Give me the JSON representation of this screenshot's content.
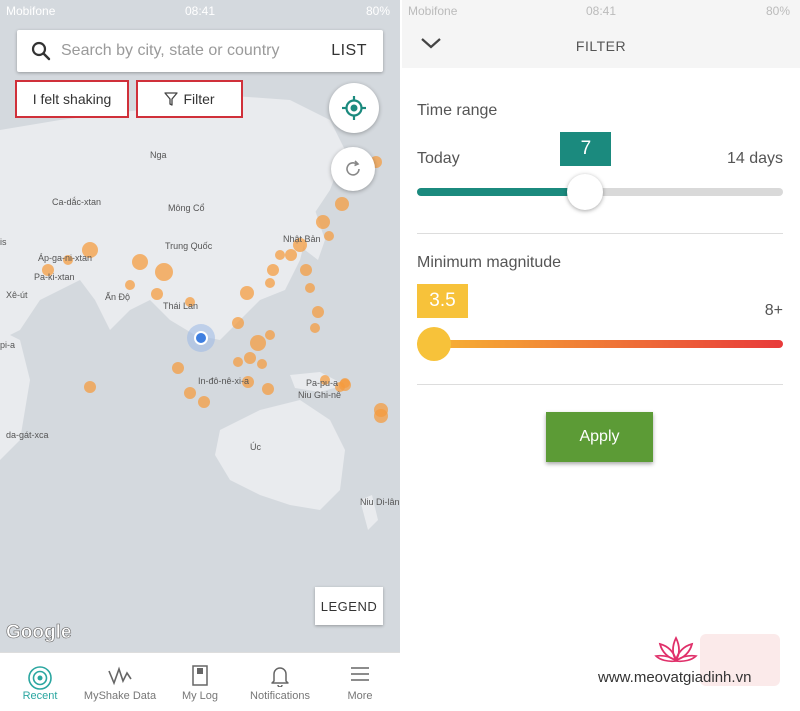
{
  "left_screen": {
    "status": {
      "carrier": "Mobifone",
      "time": "08:41",
      "battery": "80%"
    },
    "search": {
      "placeholder": "Search by city, state or country",
      "list_label": "LIST"
    },
    "chips": {
      "felt_shaking": "I felt shaking",
      "filter": "Filter"
    },
    "map_labels": [
      "Ca-dắc-xtan",
      "Mông Cổ",
      "Nga",
      "Trung Quốc",
      "Nhật Bản",
      "Áp-ga-ni-xtan",
      "Pa-ki-xtan",
      "Ấn Độ",
      "Thái Lan",
      "Xê-út",
      "pi-a",
      "In-đô-nê-xi-a",
      "Pa-pu-a",
      "Niu Ghi-nê",
      "Úc",
      "da-gát-xca",
      "Niu Di-lân",
      "is"
    ],
    "legend_label": "LEGEND",
    "google_logo": "Google",
    "tabs": [
      {
        "label": "Recent",
        "icon": "recent-icon",
        "active": true
      },
      {
        "label": "MyShake Data",
        "icon": "myshake-data-icon",
        "active": false
      },
      {
        "label": "My Log",
        "icon": "my-log-icon",
        "active": false
      },
      {
        "label": "Notifications",
        "icon": "bell-icon",
        "active": false
      },
      {
        "label": "More",
        "icon": "menu-icon",
        "active": false
      }
    ]
  },
  "right_screen": {
    "status": {
      "carrier": "Mobifone",
      "time": "08:41",
      "battery": "80%"
    },
    "header": {
      "title": "FILTER"
    },
    "time_range": {
      "title": "Time range",
      "min_label": "Today",
      "max_label": "14 days",
      "value": "7",
      "fraction": 0.46
    },
    "magnitude": {
      "title": "Minimum magnitude",
      "max_label": "8+",
      "value": "3.5",
      "fraction": 0.0
    },
    "apply_label": "Apply",
    "watermark": "www.meovatgiadinh.vn"
  },
  "colors": {
    "teal": "#1b8a7e",
    "slider_gray": "#d9d9d9",
    "mag_start": "#f7b733",
    "mag_end": "#e83a3a",
    "apply_green": "#5c9b36",
    "quake_orange": "#f59a3c",
    "highlight_red": "#d0303a",
    "active_tab": "#2aa6a0"
  }
}
